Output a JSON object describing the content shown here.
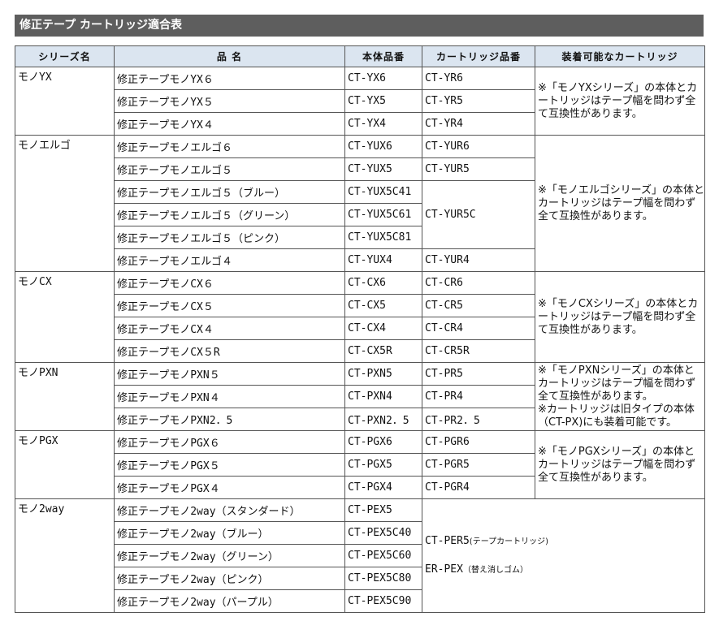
{
  "title": "修正テープ カートリッジ適合表",
  "headers": [
    "シリーズ名",
    "品 名",
    "本体品番",
    "カートリッジ品番",
    "装着可能なカートリッジ"
  ],
  "groups": [
    {
      "series": "モノYX",
      "note": [
        "※「モノYXシリーズ」の本体とカートリッジはテープ幅を問わず全て互換性があります。"
      ],
      "rows": [
        {
          "product": "修正テープモノYX６",
          "body": "CT-YX6",
          "cart": "CT-YR6"
        },
        {
          "product": "修正テープモノYX５",
          "body": "CT-YX5",
          "cart": "CT-YR5"
        },
        {
          "product": "修正テープモノYX４",
          "body": "CT-YX4",
          "cart": "CT-YR4"
        }
      ]
    },
    {
      "series": "モノエルゴ",
      "note": [
        "※「モノエルゴシリーズ」の本体とカートリッジはテープ幅を問わず全て互換性があります。"
      ],
      "rows": [
        {
          "product": "修正テープモノエルゴ６",
          "body": "CT-YUX6",
          "cart": "CT-YUR6"
        },
        {
          "product": "修正テープモノエルゴ５",
          "body": "CT-YUX5",
          "cart": "CT-YUR5"
        },
        {
          "product": "修正テープモノエルゴ５（ブルー）",
          "body": "CT-YUX5C41",
          "cart": "CT-YUR5C"
        },
        {
          "product": "修正テープモノエルゴ５（グリーン）",
          "body": "CT-YUX5C61",
          "cart": ""
        },
        {
          "product": "修正テープモノエルゴ５（ピンク）",
          "body": "CT-YUX5C81",
          "cart": ""
        },
        {
          "product": "修正テープモノエルゴ４",
          "body": "CT-YUX4",
          "cart": "CT-YUR4"
        }
      ]
    },
    {
      "series": "モノCX",
      "note": [
        "※「モノCXシリーズ」の本体とカートリッジはテープ幅を問わず全て互換性があります。"
      ],
      "rows": [
        {
          "product": "修正テープモノCX６",
          "body": "CT-CX6",
          "cart": "CT-CR6"
        },
        {
          "product": "修正テープモノCX５",
          "body": "CT-CX5",
          "cart": "CT-CR5"
        },
        {
          "product": "修正テープモノCX４",
          "body": "CT-CX4",
          "cart": "CT-CR4"
        },
        {
          "product": "修正テープモノCX５R",
          "body": "CT-CX5R",
          "cart": "CT-CR5R"
        }
      ]
    },
    {
      "series": "モノPXN",
      "note": [
        "※「モノPXNシリーズ」の本体とカートリッジはテープ幅を問わず全て互換性があります。",
        "※カートリッジは旧タイプの本体（CT-PX)にも装着可能です。"
      ],
      "rows": [
        {
          "product": "修正テープモノPXN５",
          "body": "CT-PXN5",
          "cart": "CT-PR5"
        },
        {
          "product": "修正テープモノPXN４",
          "body": "CT-PXN4",
          "cart": "CT-PR4"
        },
        {
          "product": "修正テープモノPXN2．5",
          "body": "CT-PXN2．5",
          "cart": "CT-PR2．5"
        }
      ]
    },
    {
      "series": "モノPGX",
      "note": [
        "※「モノPGXシリーズ」の本体とカートリッジはテープ幅を問わず全て互換性があります。"
      ],
      "rows": [
        {
          "product": "修正テープモノPGX６",
          "body": "CT-PGX6",
          "cart": "CT-PGR6"
        },
        {
          "product": "修正テープモノPGX５",
          "body": "CT-PGX5",
          "cart": "CT-PGR5"
        },
        {
          "product": "修正テープモノPGX４",
          "body": "CT-PGX4",
          "cart": "CT-PGR4"
        }
      ]
    },
    {
      "series": "モノ2way",
      "combined_note": [
        {
          "main": "CT-PER5",
          "sub": "(テープカートリッジ)"
        },
        {
          "main": "ER-PEX",
          "sub": "（替え消しゴム）"
        }
      ],
      "rows": [
        {
          "product": "修正テープモノ2way（スタンダード）",
          "body": "CT-PEX5"
        },
        {
          "product": "修正テープモノ2way（ブルー）",
          "body": "CT-PEX5C40"
        },
        {
          "product": "修正テープモノ2way（グリーン）",
          "body": "CT-PEX5C60"
        },
        {
          "product": "修正テープモノ2way（ピンク）",
          "body": "CT-PEX5C80"
        },
        {
          "product": "修正テープモノ2way（パープル）",
          "body": "CT-PEX5C90"
        }
      ]
    }
  ]
}
